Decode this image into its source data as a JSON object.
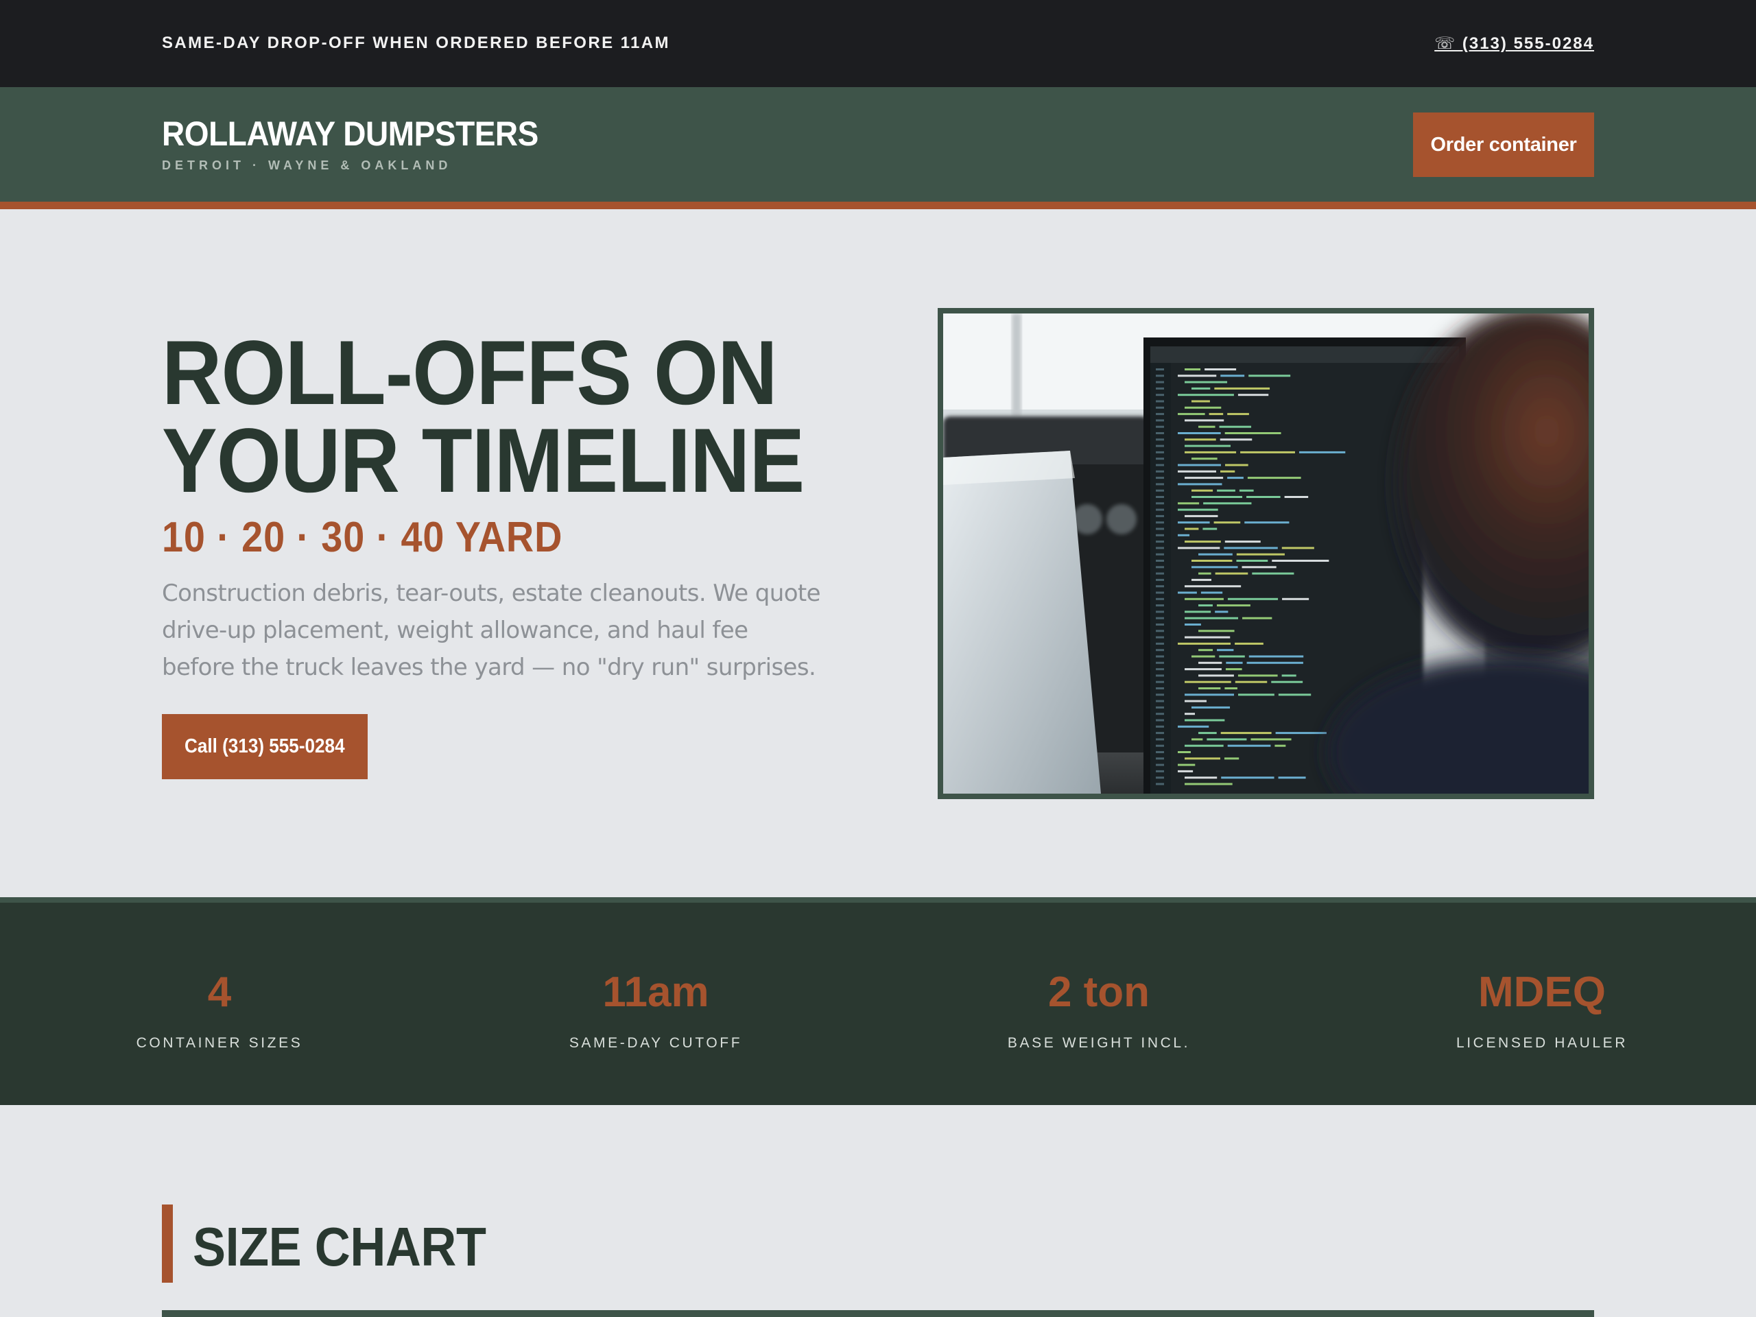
{
  "topbar": {
    "notice": "SAME-DAY DROP-OFF WHEN ORDERED BEFORE 11AM",
    "phone": "☏ (313) 555-0284"
  },
  "header": {
    "brand_name": "ROLLAWAY DUMPSTERS",
    "brand_sub": "DETROIT · WAYNE & OAKLAND",
    "order_button": "Order container"
  },
  "hero": {
    "title_lines": [
      "ROLL-OFFS ON",
      "YOUR TIMELINE"
    ],
    "sizes": "10 · 20 · 30 · 40 YARD",
    "description": "Construction debris, tear-outs, estate cleanouts. We quote drive-up placement, weight allowance, and haul fee before the truck leaves the yard — no \"dry run\" surprises.",
    "call_button": "Call (313) 555-0284",
    "image_icon": "developer-monitors-photo"
  },
  "stats": [
    {
      "value": "4",
      "label": "CONTAINER SIZES"
    },
    {
      "value": "11am",
      "label": "SAME-DAY CUTOFF"
    },
    {
      "value": "2 ton",
      "label": "BASE WEIGHT INCL."
    },
    {
      "value": "MDEQ",
      "label": "LICENSED HAULER"
    }
  ],
  "size_chart": {
    "title": "SIZE CHART"
  },
  "colors": {
    "dark_bar": "#1c1d20",
    "header_green": "#3e5449",
    "deep_green": "#2a3830",
    "rust": "#a6532e",
    "page_bg": "#e5e7ea"
  }
}
